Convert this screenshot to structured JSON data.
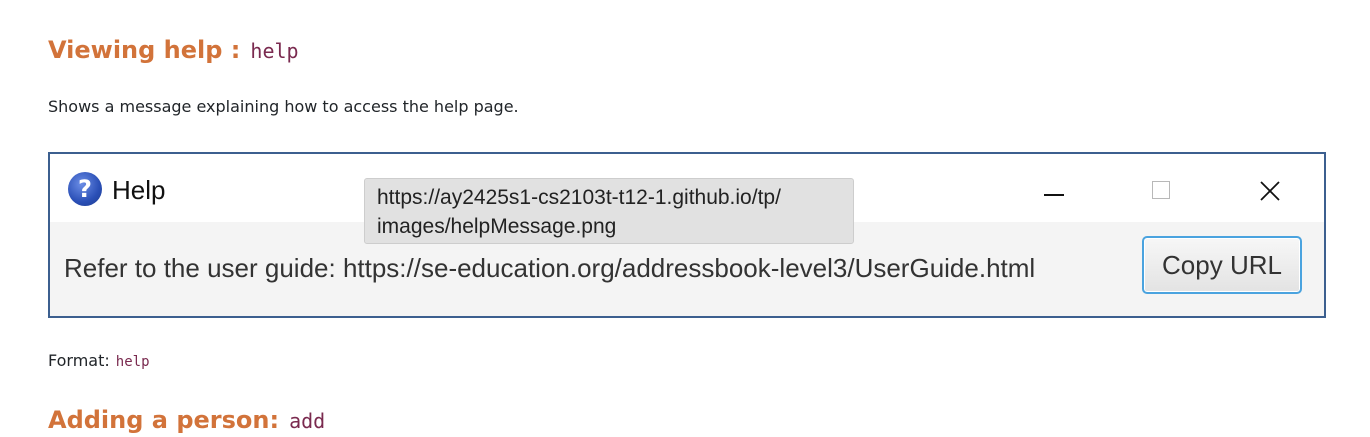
{
  "section": {
    "title": "Viewing help :",
    "command": "help",
    "description": "Shows a message explaining how to access the help page."
  },
  "help_window": {
    "icon": "help-question-icon",
    "title": "Help",
    "guide_text": "Refer to the user guide: https://se-education.org/addressbook-level3/UserGuide.html",
    "copy_button_label": "Copy URL",
    "controls": [
      "minimize-icon",
      "maximize-icon",
      "close-icon"
    ],
    "border_color": "#3c5f8f",
    "button_focus_color": "#4aa3df"
  },
  "tooltip": {
    "line1": "https://ay2425s1-cs2103t-t12-1.github.io/tp/",
    "line2": "images/helpMessage.png"
  },
  "format": {
    "label": "Format:",
    "command": "help"
  },
  "next_section": {
    "title": "Adding a person:",
    "command": "add"
  },
  "colors": {
    "heading": "#d2733a",
    "code": "#7a2a4f"
  }
}
